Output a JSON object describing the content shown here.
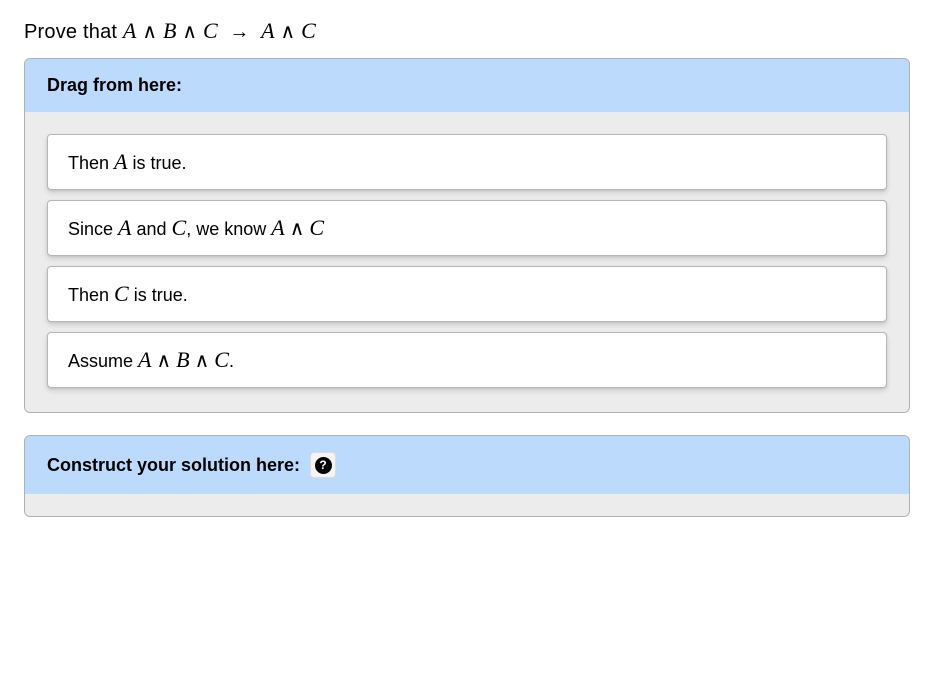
{
  "prompt": {
    "lead": "Prove that ",
    "formula_parts": {
      "A": "A",
      "B": "B",
      "C": "C",
      "and": "∧",
      "implies": "→"
    }
  },
  "source_panel": {
    "header": "Drag from here:",
    "items": [
      {
        "pre": "Then ",
        "m1": "A",
        "post": " is true."
      },
      {
        "pre": "Since ",
        "m1": "A",
        "mid1": " and ",
        "m2": "C",
        "mid2": ", we know ",
        "m3": "A",
        "op": "∧",
        "m4": "C",
        "post": ""
      },
      {
        "pre": "Then ",
        "m1": "C",
        "post": " is true."
      },
      {
        "pre": "Assume ",
        "m1": "A",
        "op1": "∧",
        "m2": "B",
        "op2": "∧",
        "m3": "C",
        "post": "."
      }
    ]
  },
  "target_panel": {
    "header": "Construct your solution here:",
    "help_tooltip": "?"
  }
}
